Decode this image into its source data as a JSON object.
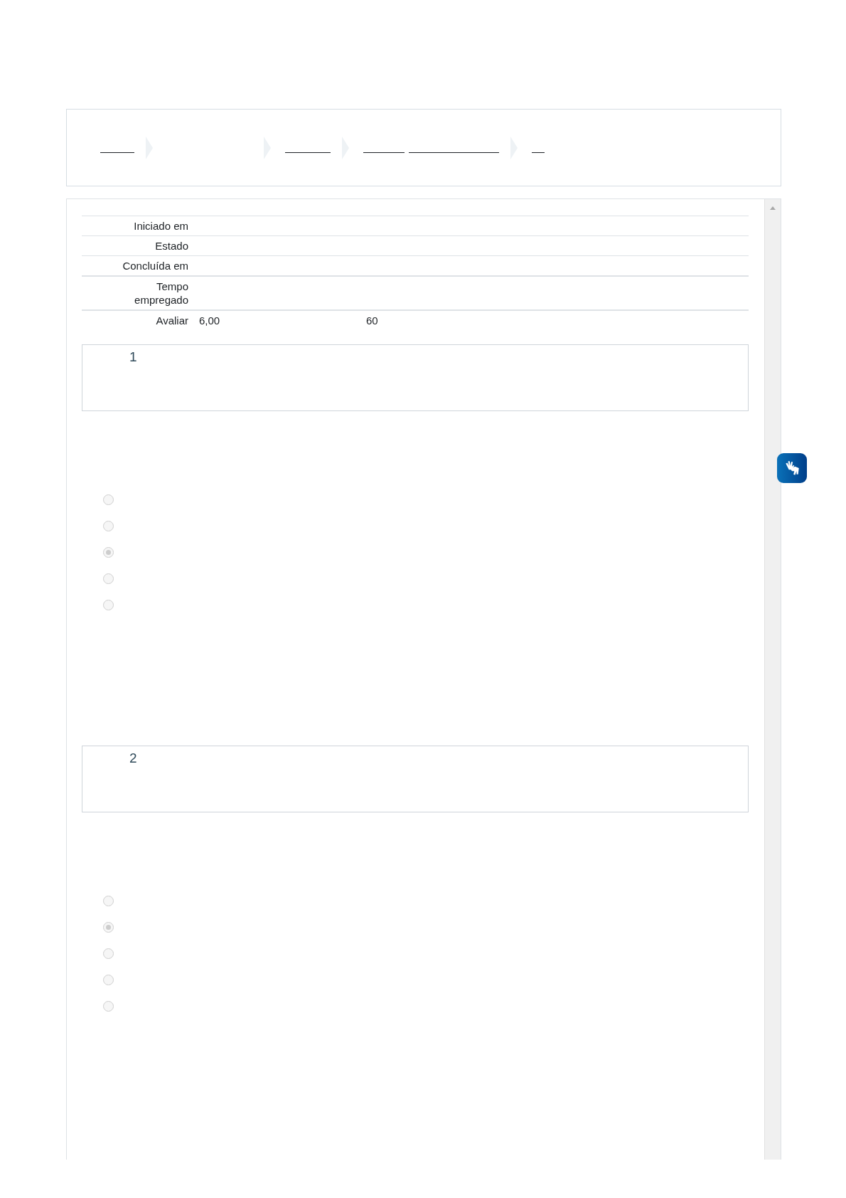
{
  "summary": [
    {
      "label": "Iniciado em"
    },
    {
      "label": "Estado"
    },
    {
      "label": "Concluída em"
    },
    {
      "label": "Tempo empregado"
    },
    {
      "label": "Avaliar",
      "value": "6,00",
      "note": "60"
    }
  ],
  "questions": [
    {
      "number": "1",
      "options": [
        {
          "selected": false
        },
        {
          "selected": false
        },
        {
          "selected": true
        },
        {
          "selected": false
        },
        {
          "selected": false
        }
      ]
    },
    {
      "number": "2",
      "options": [
        {
          "selected": false
        },
        {
          "selected": true
        },
        {
          "selected": false
        },
        {
          "selected": false
        },
        {
          "selected": false
        }
      ]
    }
  ]
}
